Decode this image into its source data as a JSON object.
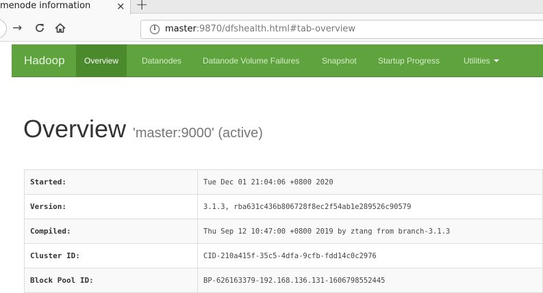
{
  "browser": {
    "tab_title": "menode information",
    "tab_close": "×",
    "new_tab": "+",
    "url_host": "master",
    "url_rest": ":9870/dfshealth.html#tab-overview"
  },
  "navbar": {
    "brand": "Hadoop",
    "items": [
      "Overview",
      "Datanodes",
      "Datanode Volume Failures",
      "Snapshot",
      "Startup Progress",
      "Utilities"
    ]
  },
  "page": {
    "title": "Overview",
    "subtitle": "'master:9000' (active)"
  },
  "overview_table": [
    {
      "key": "Started:",
      "value": "Tue Dec 01 21:04:06 +0800 2020"
    },
    {
      "key": "Version:",
      "value": "3.1.3, rba631c436b806728f8ec2f54ab1e289526c90579"
    },
    {
      "key": "Compiled:",
      "value": "Thu Sep 12 10:47:00 +0800 2019 by ztang from branch-3.1.3"
    },
    {
      "key": "Cluster ID:",
      "value": "CID-210a415f-35c5-4dfa-9cfb-fdd14c0c2976"
    },
    {
      "key": "Block Pool ID:",
      "value": "BP-626163379-192.168.136.131-1606798552445"
    }
  ]
}
